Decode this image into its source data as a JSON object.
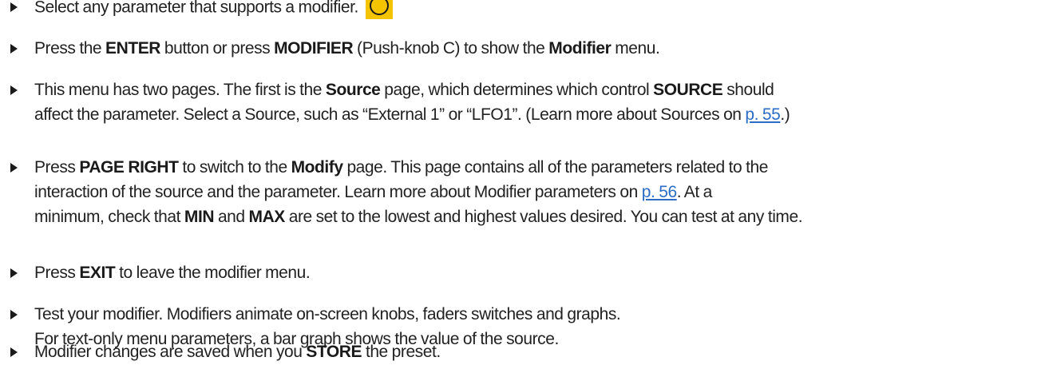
{
  "steps": [
    {
      "lines": [
        [
          {
            "t": "Select any parameter that supports a modifier. "
          }
        ]
      ],
      "icon": "modifier-encoder-icon"
    },
    {
      "lines": [
        [
          {
            "t": "Press the "
          },
          {
            "t": "ENTER",
            "b": true
          },
          {
            "t": " button or press "
          },
          {
            "t": "MODIFIER",
            "b": true
          },
          {
            "t": " (Push-knob C) to show the "
          },
          {
            "t": "Modifier",
            "b": true
          },
          {
            "t": " menu."
          }
        ]
      ]
    },
    {
      "lines": [
        [
          {
            "t": "This menu has two pages. The first is the "
          },
          {
            "t": "Source",
            "b": true
          },
          {
            "t": " page, which determines which control "
          },
          {
            "t": "SOURCE",
            "b": true
          },
          {
            "t": " should"
          }
        ],
        [
          {
            "t": "affect the parameter. Select a Source, such as “External 1” or “LFO1”. (Learn more about Sources on "
          },
          {
            "t": "p. 55",
            "link": true
          },
          {
            "t": ".)"
          }
        ]
      ]
    },
    {
      "lines": [
        [
          {
            "t": "Press "
          },
          {
            "t": "PAGE RIGHT",
            "b": true
          },
          {
            "t": " to switch to the "
          },
          {
            "t": "Modify",
            "b": true
          },
          {
            "t": " page. This page contains all of the parameters related to the"
          }
        ],
        [
          {
            "t": "interaction of the source and the parameter.  Learn more about Modifier parameters on "
          },
          {
            "t": "p. 56",
            "link": true
          },
          {
            "t": ". At a"
          }
        ],
        [
          {
            "t": "minimum, check that "
          },
          {
            "t": "MIN",
            "b": true
          },
          {
            "t": " and "
          },
          {
            "t": "MAX",
            "b": true
          },
          {
            "t": " are set to the lowest and highest values desired. You can test at any time."
          }
        ]
      ]
    },
    {
      "lines": [
        [
          {
            "t": "Press "
          },
          {
            "t": "EXIT",
            "b": true
          },
          {
            "t": " to leave the modifier menu."
          }
        ]
      ]
    },
    {
      "lines": [
        [
          {
            "t": "Test your modifier. Modifiers animate on-screen knobs, faders switches and graphs."
          }
        ],
        [
          {
            "t": "For text-only menu parameters, a bar graph shows the value of the source."
          }
        ]
      ]
    },
    {
      "lines": [
        [
          {
            "t": "Modifier changes are saved when you "
          },
          {
            "t": "STORE",
            "b": true
          },
          {
            "t": " the preset."
          }
        ]
      ]
    }
  ],
  "colors": {
    "text": "#222222",
    "link": "#2b6cc4",
    "icon_bg": "#f5c400"
  }
}
